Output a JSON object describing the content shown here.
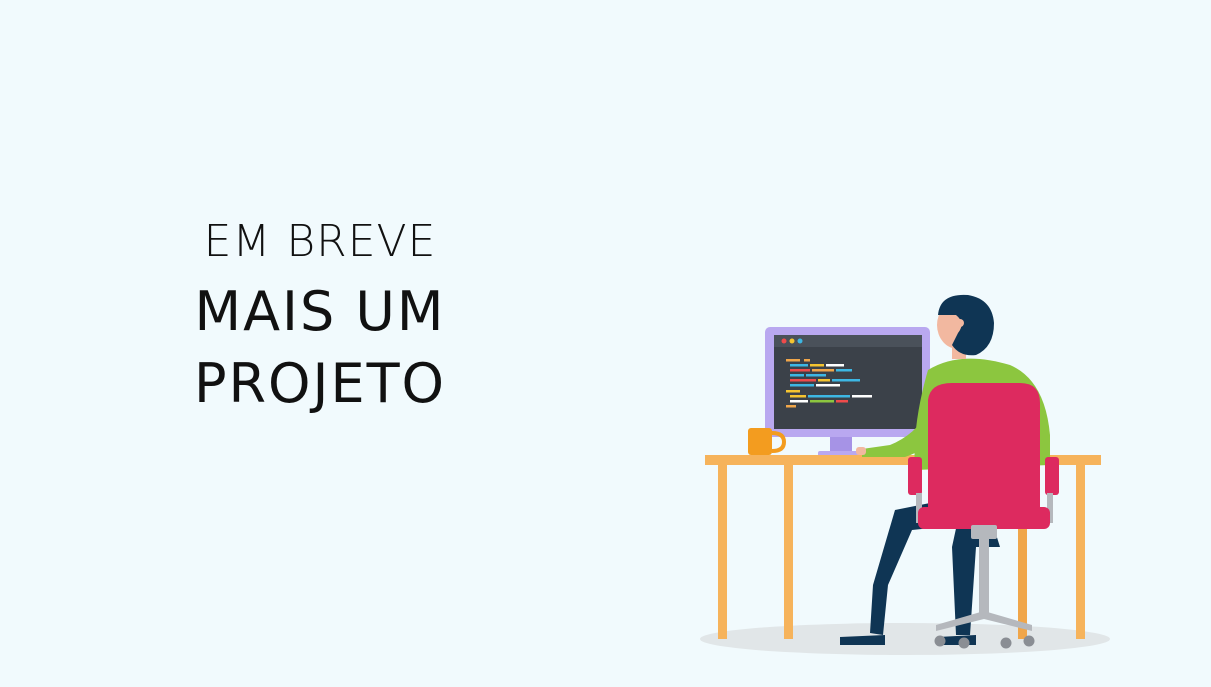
{
  "hero": {
    "subtitle": "EM BREVE",
    "title": "MAIS UM PROJETO"
  },
  "colors": {
    "background": "#f1fafd",
    "text": "#111111",
    "desk": "#f6b35b",
    "chair": "#dd2a5f",
    "shirt": "#8cc63f",
    "pants": "#0f3554",
    "monitor_frame": "#b9a8f0",
    "screen": "#3b4149",
    "mug": "#f39c1f"
  }
}
